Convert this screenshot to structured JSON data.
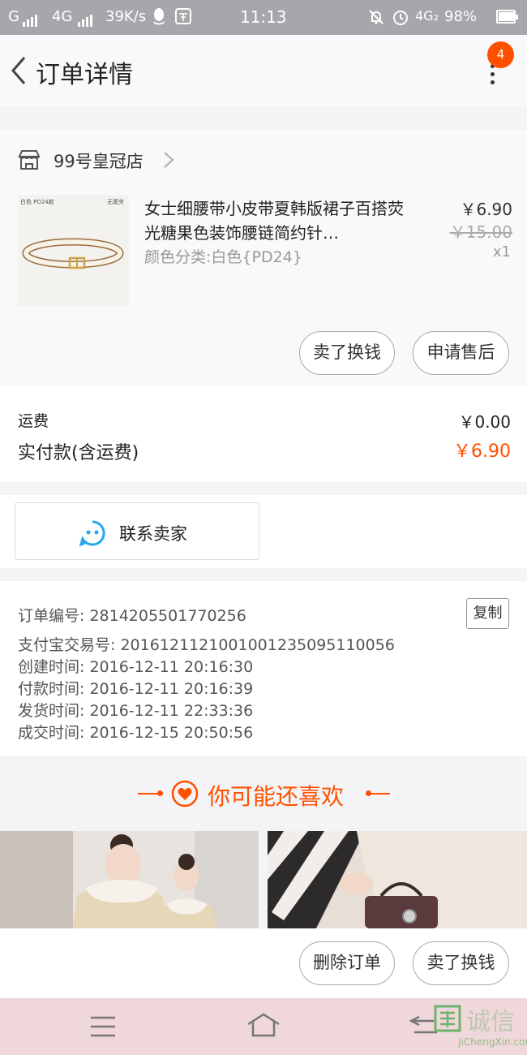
{
  "status_bar": {
    "carrier": "G",
    "network": "4G",
    "speed": "39K/s",
    "time": "11:13",
    "network2": "4G₂",
    "battery": "98%"
  },
  "header": {
    "title": "订单详情",
    "badge_count": "4"
  },
  "shop": {
    "name": "99号皇冠店"
  },
  "product": {
    "thumb_tag_left": "白色 PD24款",
    "thumb_tag_right": "无尾夹",
    "title": "女士细腰带小皮带夏韩版裙子百搭荧光糖果色装饰腰链简约针…",
    "sku": "颜色分类:白色{PD24}",
    "price": "￥6.90",
    "original_price": "￥15.00",
    "quantity": "x1",
    "btn_sell": "卖了换钱",
    "btn_after_sale": "申请售后"
  },
  "fees": {
    "shipping_label": "运费",
    "shipping_value": "￥0.00",
    "paid_label": "实付款(含运费)",
    "paid_value": "￥6.90"
  },
  "contact": {
    "label": "联系卖家"
  },
  "order_info": {
    "order_no": "订单编号: 2814205501770256",
    "copy": "复制",
    "alipay_no": "支付宝交易号: 2016121121001001235095110056",
    "created": "创建时间: 2016-12-11  20:16:30",
    "paid": "付款时间: 2016-12-11  20:16:39",
    "shipped": "发货时间: 2016-12-11  22:33:36",
    "completed": "成交时间: 2016-12-15  20:50:56"
  },
  "recommend": {
    "title": "你可能还喜欢"
  },
  "bottom_actions": {
    "delete": "删除订单",
    "sell": "卖了换钱"
  },
  "watermark": {
    "text": "诚信",
    "sub": "JiChengXin.com"
  },
  "colors": {
    "accent": "#ff5000",
    "status_bar": "#a7a7ab",
    "nav_bar": "#efd7dc"
  }
}
